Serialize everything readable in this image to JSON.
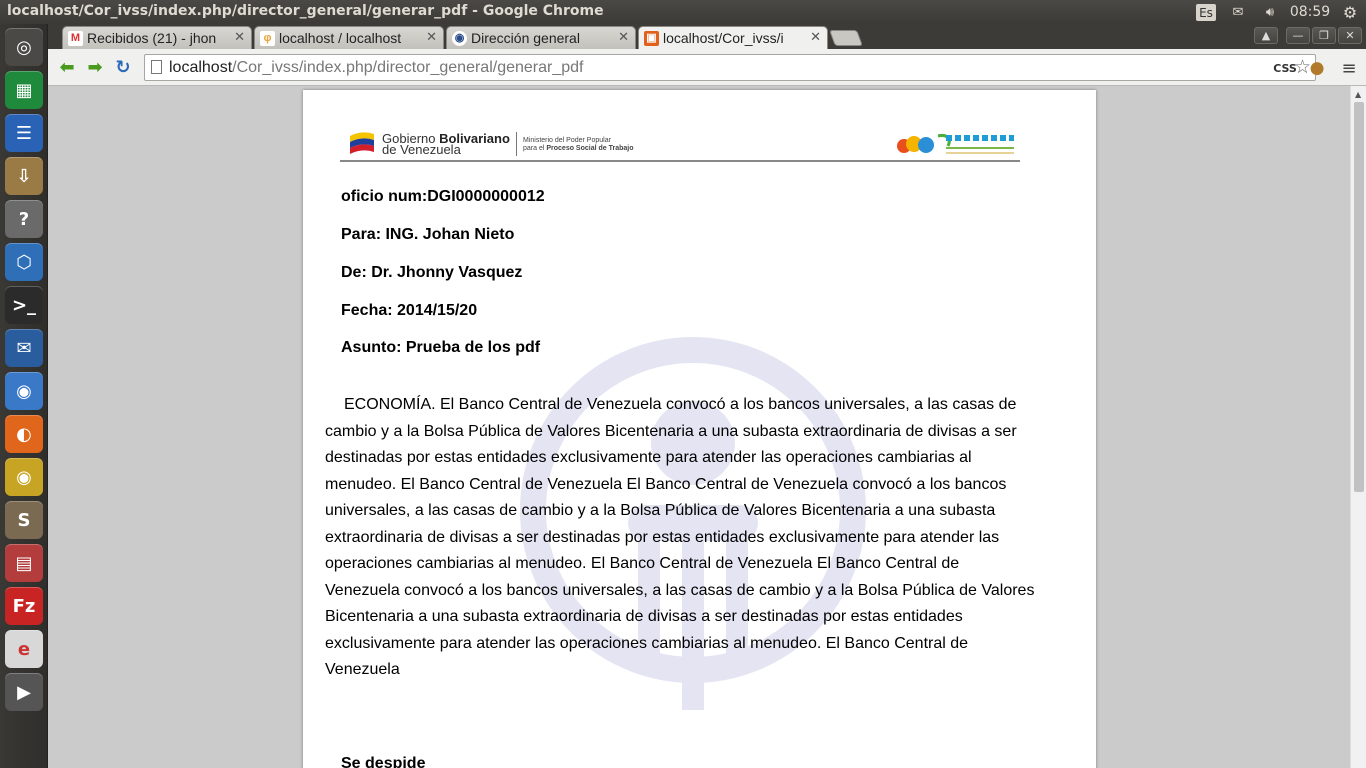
{
  "system_bar": {
    "window_title": "localhost/Cor_ivss/index.php/director_general/generar_pdf - Google Chrome",
    "keyboard_layout": "Es",
    "clock": "08:59"
  },
  "launcher": {
    "items": [
      {
        "name": "dash-home",
        "glyph": "◎",
        "color": "#4a4945"
      },
      {
        "name": "libreoffice-calc",
        "glyph": "▦",
        "color": "#1f8a3b"
      },
      {
        "name": "libreoffice-writer",
        "glyph": "☰",
        "color": "#2a62b5"
      },
      {
        "name": "archive-manager",
        "glyph": "⇩",
        "color": "#9a7a45"
      },
      {
        "name": "help",
        "glyph": "?",
        "color": "#6a6a6a"
      },
      {
        "name": "virtualbox",
        "glyph": "⬡",
        "color": "#2f6fb8"
      },
      {
        "name": "terminal",
        "glyph": ">_",
        "color": "#2b2b2b"
      },
      {
        "name": "thunderbird",
        "glyph": "✉",
        "color": "#2a5d9e"
      },
      {
        "name": "chromium",
        "glyph": "◉",
        "color": "#3a78c8"
      },
      {
        "name": "firefox",
        "glyph": "◐",
        "color": "#e0661c"
      },
      {
        "name": "google-chrome",
        "glyph": "◉",
        "color": "#c8a424"
      },
      {
        "name": "sublime-text",
        "glyph": "S",
        "color": "#7a6a52"
      },
      {
        "name": "files",
        "glyph": "▤",
        "color": "#b33d3d"
      },
      {
        "name": "filezilla",
        "glyph": "Fz",
        "color": "#c82424"
      },
      {
        "name": "editor",
        "glyph": "e",
        "color": "#d8d8d8"
      },
      {
        "name": "media-tools",
        "glyph": "▶",
        "color": "#555555"
      }
    ]
  },
  "tabs": [
    {
      "label": "Recibidos (21) - jhon",
      "icon": "M",
      "icon_color": "#d33"
    },
    {
      "label": "localhost / localhost",
      "icon": "φ",
      "icon_color": "#e8a33a"
    },
    {
      "label": "Dirección general",
      "icon": "◉",
      "icon_color": "#2a4e8a"
    },
    {
      "label": "localhost/Cor_ivss/i",
      "icon": "▣",
      "icon_color": "#e0601c"
    }
  ],
  "toolbar": {
    "url_host": "localhost",
    "url_path": "/Cor_ivss/index.php/director_general/generar_pdf",
    "css_ext_label": "CSS"
  },
  "document": {
    "gov_name_line1_normal": "Gobierno ",
    "gov_name_line1_bold": "Bolivariano",
    "gov_name_line2": "de Venezuela",
    "ministry_line1": "Ministerio del Poder Popular",
    "ministry_line2_normal": "para el ",
    "ministry_line2_bold": "Proceso Social de Trabajo",
    "oficio": "oficio num:DGI0000000012",
    "para": "Para: ING. Johan Nieto",
    "de": "De: Dr. Jhonny Vasquez",
    "fecha": "Fecha: 2014/15/20",
    "asunto": "Asunto: Prueba de los pdf",
    "body": "ECONOMÍA. El Banco Central de Venezuela convocó a los bancos universales, a las casas de cambio y a la Bolsa Pública de Valores  Bicentenaria a una subasta extraordinaria de divisas a ser destinadas por estas entidades exclusivamente para atender las operaciones cambiarias al menudeo. El Banco Central de Venezuela El Banco Central de Venezuela convocó a los bancos universales, a las casas de cambio y a la Bolsa Pública de Valores  Bicentenaria a una subasta extraordinaria de divisas a ser destinadas por estas entidades exclusivamente para atender las operaciones cambiarias al menudeo. El Banco Central de Venezuela El Banco Central de Venezuela convocó a los bancos universales, a las casas de cambio y a la Bolsa Pública de Valores  Bicentenaria a una subasta extraordinaria de divisas a ser destinadas por estas entidades exclusivamente para atender las operaciones cambiarias al menudeo. El Banco Central de Venezuela",
    "closing": "Se despide"
  }
}
